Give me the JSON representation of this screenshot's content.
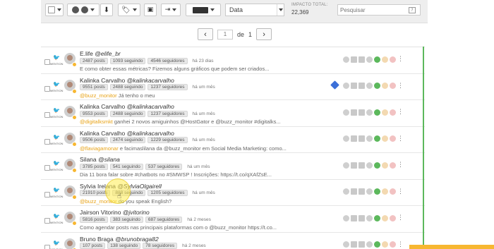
{
  "toolbar": {
    "sort_value": "Data",
    "impact_label": "IMPACTO TOTAL:",
    "impact_value": "22,369",
    "search_placeholder": "Pesquisar",
    "avatar_badge": "🂠"
  },
  "pager": {
    "page": "1",
    "of_label": "de",
    "total": "1",
    "prev": "‹",
    "next": "›"
  },
  "network_label": "MENTION",
  "rows": [
    {
      "name": "E.life",
      "handle": "@elife_br",
      "posts": "2487 posts",
      "following": "1093 seguindo",
      "followers": "4546 seguidores",
      "time": "há 23 dias",
      "text_plain": "E como obter essas métricas? Fizemos alguns gráficos que podem ser criados...",
      "highlight": "",
      "text_after": ""
    },
    {
      "name": "Kalinka Carvalho",
      "handle": "@kalinkacarvalho",
      "posts": "9551 posts",
      "following": "2488 seguindo",
      "followers": "1237 seguidores",
      "time": "há um mês",
      "highlight": "@buzz_monitor",
      "text_after": " Já tenho o meu",
      "text_plain": ""
    },
    {
      "name": "Kalinka Carvalho",
      "handle": "@kalinkacarvalho",
      "posts": "9553 posts",
      "following": "2488 seguindo",
      "followers": "1237 seguidores",
      "time": "há um mês",
      "highlight": "@digitalksmkt",
      "text_after": " ganhei 2 novos amiguinhos @HostGator e @buzz_monitor #digitalks...",
      "text_plain": ""
    },
    {
      "name": "Kalinka Carvalho",
      "handle": "@kalinkacarvalho",
      "posts": "9506 posts",
      "following": "2474 seguindo",
      "followers": "1229 seguidores",
      "time": "há um mês",
      "highlight": "@flaviagamonar",
      "text_after": " e facimaslilana da @buzz_monitor em Social Media Marketing: como...",
      "text_plain": ""
    },
    {
      "name": "Silana",
      "handle": "@silana",
      "posts": "3785 posts",
      "following": "541 seguindo",
      "followers": "537 seguidores",
      "time": "há um mês",
      "text_plain": "Dia 11 bora falar sobre #chatbots no #SMWSP ! Inscrições: https://t.co/qXAfZsE...",
      "highlight": "",
      "text_after": ""
    },
    {
      "name": "Sylvia Irelana",
      "handle": "@SylviaOlgairell",
      "posts": "21910 posts",
      "following": "888 seguindo",
      "followers": "1205 seguidores",
      "time": "há um mês",
      "highlight": "@buzz_monitor",
      "text_after": " do you speak English?",
      "text_plain": ""
    },
    {
      "name": "Jairson Vitorino",
      "handle": "@jvitorino",
      "posts": "5816 posts",
      "following": "383 seguindo",
      "followers": "687 seguidores",
      "time": "há 2 meses",
      "text_plain": "Como agendar posts nas principais plataformas com o @buzz_monitor https://t.co...",
      "highlight": "",
      "text_after": ""
    },
    {
      "name": "Bruno Braga",
      "handle": "@brunobraga82",
      "posts": "107 posts",
      "following": "138 seguindo",
      "followers": "78 seguidores",
      "time": "há 2 meses",
      "text_plain": "",
      "highlight": "",
      "text_after": ""
    }
  ]
}
